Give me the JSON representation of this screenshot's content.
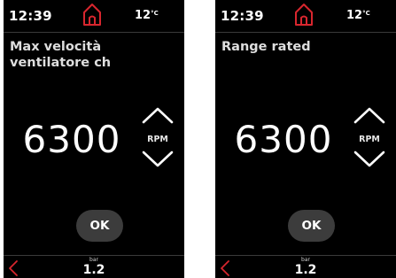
{
  "theme": {
    "background": "#000000",
    "text": "#ffffff",
    "accent": "#d8262e",
    "button_bg": "#3c3c3c"
  },
  "screens": [
    {
      "status": {
        "time": "12:39",
        "temperature": "12",
        "temperature_unit": "°C",
        "home_icon": "home-icon"
      },
      "parameter_title": "Max velocità ventilatore ch",
      "value": "6300",
      "unit": "RPM",
      "increase_icon": "chevron-up-icon",
      "decrease_icon": "chevron-down-icon",
      "ok_label": "OK",
      "back_icon": "chevron-left-icon",
      "pressure": {
        "unit": "bar",
        "value": "1.2"
      }
    },
    {
      "status": {
        "time": "12:39",
        "temperature": "12",
        "temperature_unit": "°C",
        "home_icon": "home-icon"
      },
      "parameter_title": "Range rated",
      "value": "6300",
      "unit": "RPM",
      "increase_icon": "chevron-up-icon",
      "decrease_icon": "chevron-down-icon",
      "ok_label": "OK",
      "back_icon": "chevron-left-icon",
      "pressure": {
        "unit": "bar",
        "value": "1.2"
      }
    }
  ]
}
